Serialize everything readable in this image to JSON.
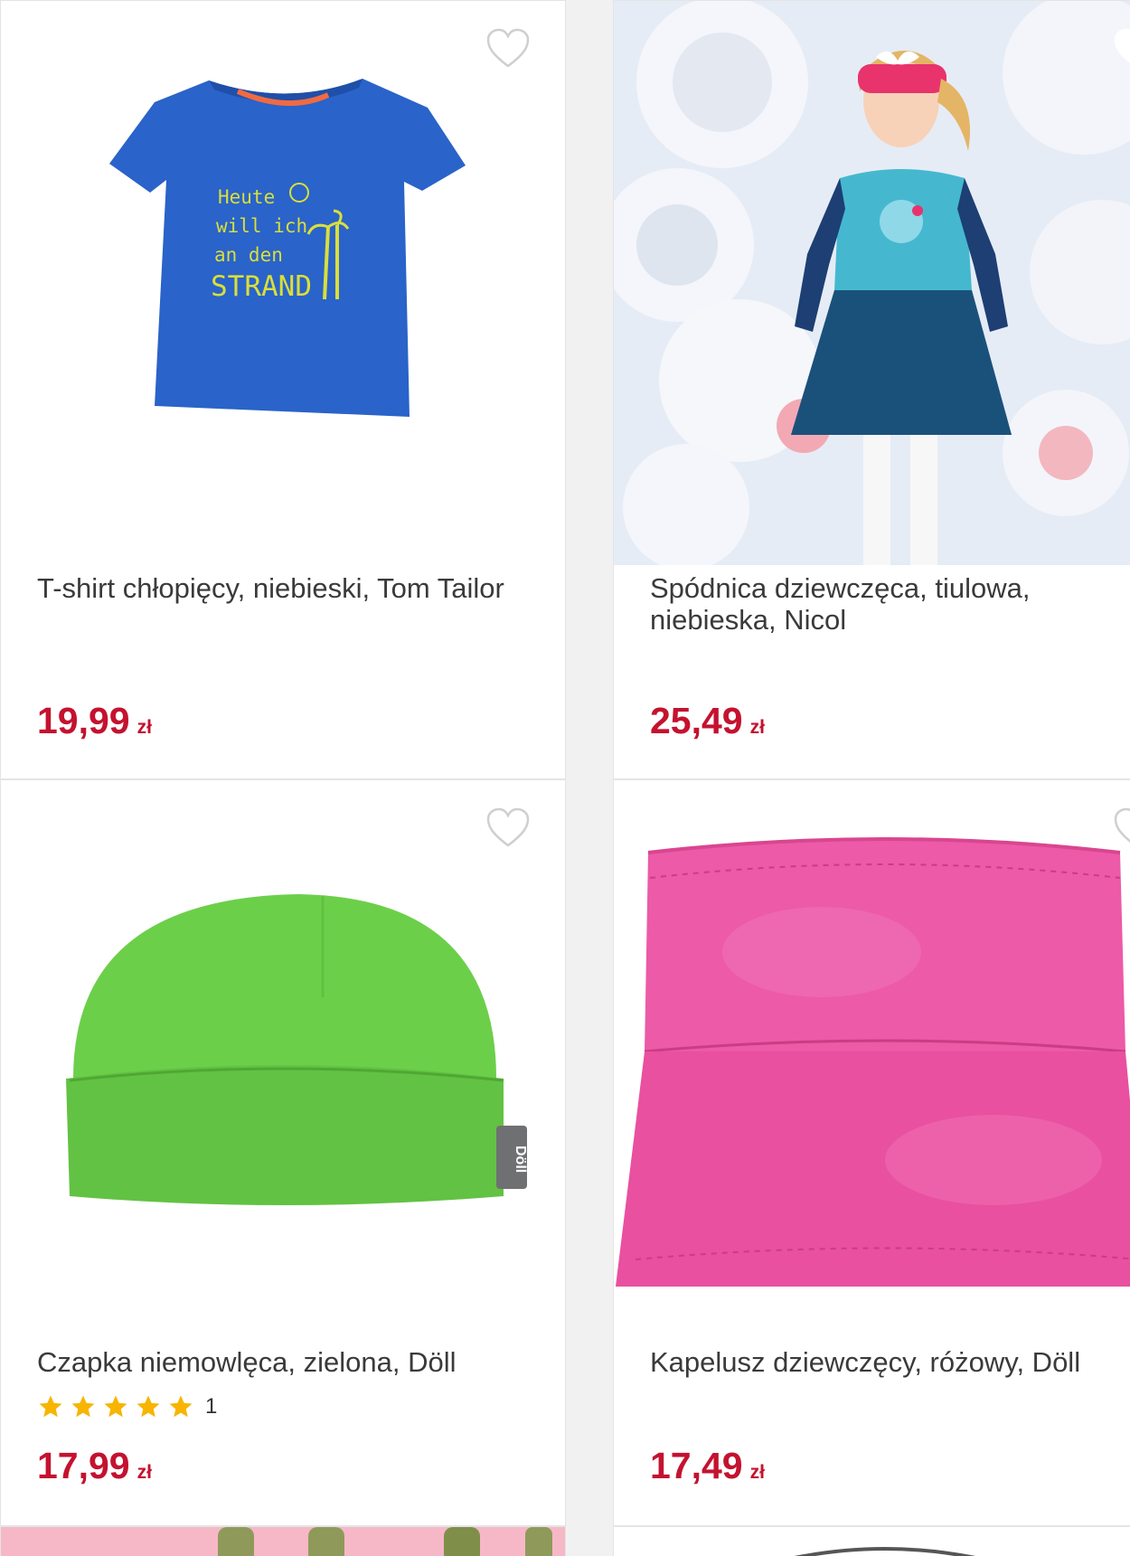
{
  "products": [
    {
      "title": "T-shirt chłopięcy, niebieski, Tom Tailor",
      "price": "19,99",
      "currency": "zł",
      "image": "blue-tshirt-image",
      "shirt_text": [
        "Heute",
        "will ich",
        "an den",
        "STRAND"
      ],
      "favorite_icon": "heart-outline-icon"
    },
    {
      "title": "Spódnica dziewczęca, tiulowa, niebieska, Nicol",
      "price": "25,49",
      "currency": "zł",
      "image": "girl-in-tulle-skirt-image",
      "favorite_icon": "heart-outline-icon"
    },
    {
      "title": "Czapka niemowlęca, zielona, Döll",
      "price": "17,99",
      "currency": "zł",
      "image": "green-baby-hat-image",
      "tag_text": "Döll",
      "rating_stars": 5,
      "rating_count": "1",
      "favorite_icon": "heart-outline-icon"
    },
    {
      "title": "Kapelusz dziewczęcy, różowy, Döll",
      "price": "17,49",
      "currency": "zł",
      "image": "pink-bucket-hat-image",
      "favorite_icon": "heart-outline-icon"
    }
  ],
  "colors": {
    "price": "#c4122f",
    "star": "#f7b500",
    "background": "#f1f1f1"
  }
}
